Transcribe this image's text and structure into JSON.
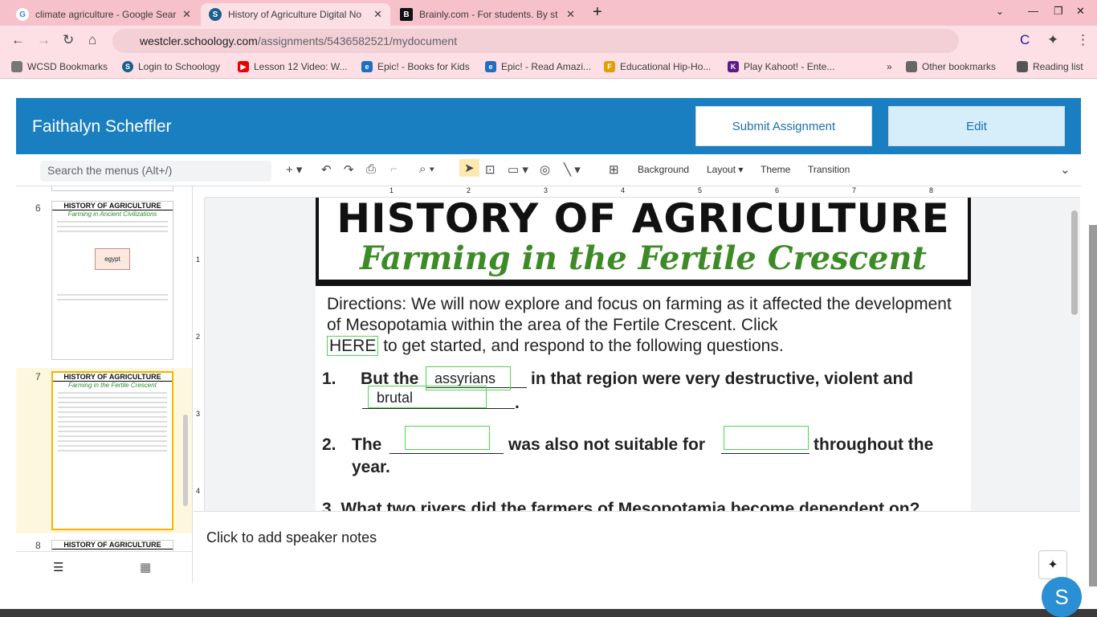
{
  "browser": {
    "tabs": [
      {
        "title": "climate agriculture - Google Sear",
        "icon": "google-icon"
      },
      {
        "title": "History of Agriculture Digital No",
        "icon": "schoology-icon",
        "active": true
      },
      {
        "title": "Brainly.com - For students. By st",
        "icon": "brainly-icon"
      }
    ],
    "url_domain": "westcler.schoology.com",
    "url_path": "/assignments/5436582521/mydocument",
    "bookmarks": [
      "WCSD Bookmarks",
      "Login to Schoology",
      "Lesson 12 Video: W...",
      "Epic! - Books for Kids",
      "Epic! - Read Amazi...",
      "Educational Hip-Ho...",
      "Play Kahoot! - Ente..."
    ],
    "other_bookmarks": "Other bookmarks",
    "reading_list": "Reading list"
  },
  "header": {
    "user_name": "Faithalyn Scheffler",
    "submit_label": "Submit Assignment",
    "edit_label": "Edit"
  },
  "toolbar": {
    "search_placeholder": "Search the menus (Alt+/)",
    "background": "Background",
    "layout": "Layout",
    "theme": "Theme",
    "transition": "Transition"
  },
  "filmstrip": {
    "slides": [
      {
        "num": "6",
        "title": "HISTORY OF AGRICULTURE",
        "subtitle": "Farming in Ancient Civilizations",
        "answer": "egypt"
      },
      {
        "num": "7",
        "title": "HISTORY OF AGRICULTURE",
        "subtitle": "Farming in the Fertile Crescent"
      },
      {
        "num": "8",
        "title": "HISTORY OF AGRICULTURE"
      }
    ]
  },
  "ruler": {
    "h": [
      "1",
      "2",
      "3",
      "4",
      "5",
      "6",
      "7",
      "8"
    ],
    "v": [
      "1",
      "2",
      "3",
      "4"
    ]
  },
  "slide": {
    "title": "HISTORY OF AGRICULTURE",
    "subtitle": "Farming in the Fertile Crescent",
    "directions": "Directions:  We will now explore and focus on farming as it affected the development of Mesopotamia within the area of the Fertile Crescent.  Click",
    "here": "HERE",
    "directions_end": "to get started, and respond to the following questions.",
    "q1_num": "1.",
    "q1_a": "But the",
    "q1_b": "in that region were very destructive, violent and",
    "q1_ans1": "assyrians",
    "q1_ans2": "brutal",
    "q2_num": "2.",
    "q2_a": "The",
    "q2_b": "was also not suitable for",
    "q2_c": "throughout the",
    "q2_d": "year.",
    "q3": "3.   What two rivers did the farmers of Mesopotamia become dependent on?"
  },
  "notes": {
    "placeholder": "Click to add speaker notes"
  },
  "chat": {
    "letter": "S"
  }
}
